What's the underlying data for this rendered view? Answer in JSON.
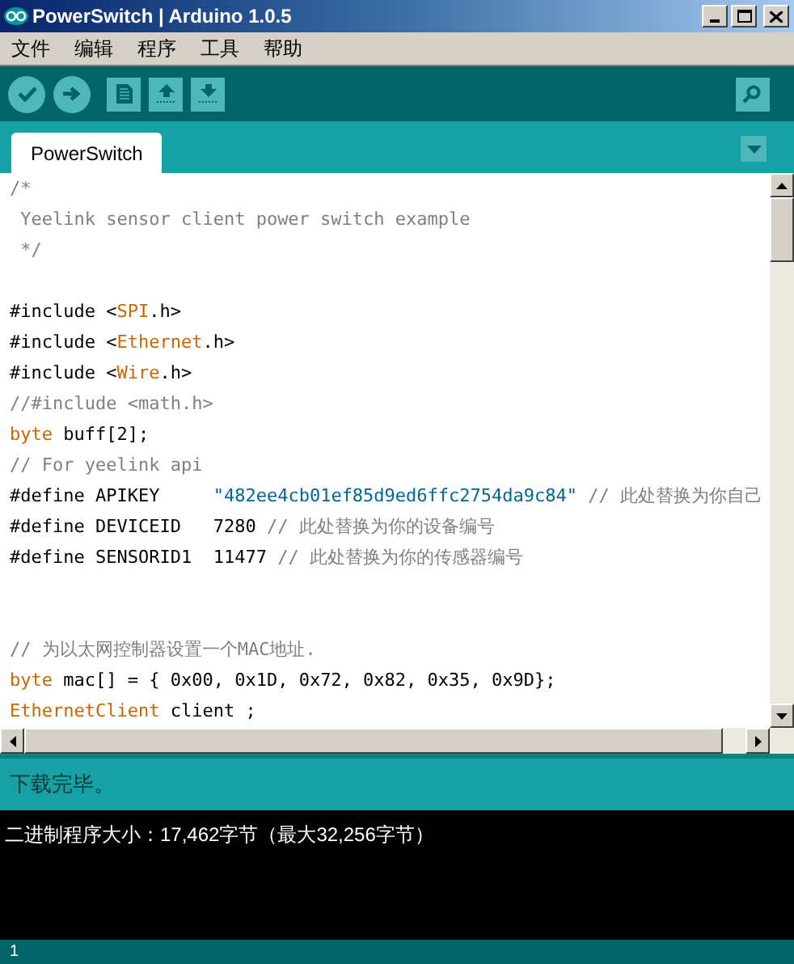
{
  "window": {
    "title": "PowerSwitch | Arduino 1.0.5"
  },
  "menu": [
    "文件",
    "编辑",
    "程序",
    "工具",
    "帮助"
  ],
  "tabs": [
    {
      "label": "PowerSwitch",
      "selected": true
    }
  ],
  "editor": {
    "lines": [
      {
        "kind": "code",
        "segments": [
          {
            "text": "/*",
            "kind": "comment"
          }
        ]
      },
      {
        "kind": "code",
        "segments": [
          {
            "text": " Yeelink sensor client power switch example",
            "kind": "comment"
          }
        ]
      },
      {
        "kind": "code",
        "segments": [
          {
            "text": " */",
            "kind": "comment"
          }
        ]
      },
      {
        "kind": "blank"
      },
      {
        "kind": "code",
        "segments": [
          {
            "text": "#include <",
            "kind": "plain"
          },
          {
            "text": "SPI",
            "kind": "keyword"
          },
          {
            "text": ".h>",
            "kind": "plain"
          }
        ]
      },
      {
        "kind": "code",
        "segments": [
          {
            "text": "#include <",
            "kind": "plain"
          },
          {
            "text": "Ethernet",
            "kind": "keyword"
          },
          {
            "text": ".h>",
            "kind": "plain"
          }
        ]
      },
      {
        "kind": "code",
        "segments": [
          {
            "text": "#include <",
            "kind": "plain"
          },
          {
            "text": "Wire",
            "kind": "keyword"
          },
          {
            "text": ".h>",
            "kind": "plain"
          }
        ]
      },
      {
        "kind": "code",
        "segments": [
          {
            "text": "//#include <math.h>",
            "kind": "comment"
          }
        ]
      },
      {
        "kind": "code",
        "segments": [
          {
            "text": "byte",
            "kind": "keyword"
          },
          {
            "text": " buff[2];",
            "kind": "plain"
          }
        ]
      },
      {
        "kind": "code",
        "segments": [
          {
            "text": "// For yeelink api",
            "kind": "comment"
          }
        ]
      },
      {
        "kind": "code",
        "segments": [
          {
            "text": "#define APIKEY     ",
            "kind": "plain"
          },
          {
            "text": "\"482ee4cb01ef85d9ed6ffc2754da9c84\"",
            "kind": "string"
          },
          {
            "text": " // 此处替换为你自己",
            "kind": "comment"
          }
        ]
      },
      {
        "kind": "code",
        "segments": [
          {
            "text": "#define DEVICEID   7280",
            "kind": "plain"
          },
          {
            "text": " // 此处替换为你的设备编号",
            "kind": "comment"
          }
        ]
      },
      {
        "kind": "code",
        "segments": [
          {
            "text": "#define SENSORID1  11477",
            "kind": "plain"
          },
          {
            "text": " // 此处替换为你的传感器编号",
            "kind": "comment"
          }
        ]
      },
      {
        "kind": "blank"
      },
      {
        "kind": "blank"
      },
      {
        "kind": "code",
        "segments": [
          {
            "text": "// 为以太网控制器设置一个MAC地址.",
            "kind": "comment"
          }
        ]
      },
      {
        "kind": "code",
        "segments": [
          {
            "text": "byte",
            "kind": "keyword"
          },
          {
            "text": " mac[] = { 0x00, 0x1D, 0x72, 0x82, 0x35, 0x9D};",
            "kind": "plain"
          }
        ]
      },
      {
        "kind": "code",
        "segments": [
          {
            "text": "EthernetClient",
            "kind": "keyword"
          },
          {
            "text": " client ;",
            "kind": "plain"
          }
        ]
      }
    ]
  },
  "status": "下载完毕。",
  "console": [
    "二进制程序大小：17,462字节（最大32,256字节）"
  ],
  "line_number": "1"
}
